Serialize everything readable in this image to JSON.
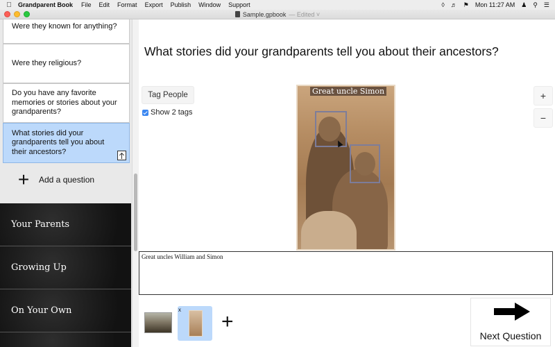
{
  "menubar": {
    "app_name": "Grandparent Book",
    "menus": [
      "File",
      "Edit",
      "Format",
      "Export",
      "Publish",
      "Window",
      "Support"
    ],
    "clock": "Mon 11:27 AM"
  },
  "window": {
    "doc_name": "Sample.gpbook",
    "status": "— Edited ˅"
  },
  "sidebar": {
    "questions": [
      "Were they known for anything?",
      "Were they religious?",
      "Do you have any favorite memories or stories about your grandparents?",
      "What stories did your grandparents tell you about their ancestors?"
    ],
    "add_question_label": "Add a question",
    "add_question_icon": "+",
    "sections": [
      "Your Parents",
      "Growing Up",
      "On Your Own"
    ]
  },
  "main": {
    "question_title": "What stories did your grandparents tell you about their ancestors?",
    "tag_people_label": "Tag People",
    "show_tags_label": "Show 2 tags",
    "photo_tag_label": "Great uncle Simon",
    "zoom_in": "+",
    "zoom_out": "−",
    "caption": "Great uncles William and Simon",
    "thumb_remove": "x",
    "add_photo": "+",
    "next_label": "Next Question"
  },
  "colors": {
    "selected_bg": "#bcd9fb",
    "checkbox": "#3b87f1"
  }
}
